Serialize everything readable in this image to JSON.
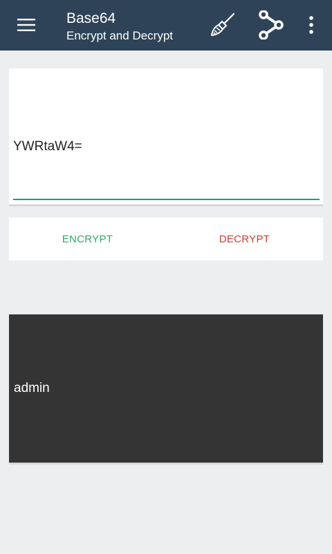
{
  "app": {
    "title": "Base64",
    "subtitle": "Encrypt and Decrypt"
  },
  "toolbar": {
    "menu_icon": "hamburger-menu-icon",
    "clean_icon": "broom-icon",
    "share_icon": "share-icon",
    "more_icon": "more-vertical-icon"
  },
  "input": {
    "value": "YWRtaW4="
  },
  "actions": {
    "encrypt_label": "ENCRYPT",
    "decrypt_label": "DECRYPT"
  },
  "output": {
    "value": "admin"
  },
  "colors": {
    "appbar": "#2f4358",
    "accent_underline": "#1a9a8a",
    "encrypt": "#2ea96b",
    "decrypt": "#d03a30",
    "output_bg": "#343434",
    "page_bg": "#eceef0"
  }
}
